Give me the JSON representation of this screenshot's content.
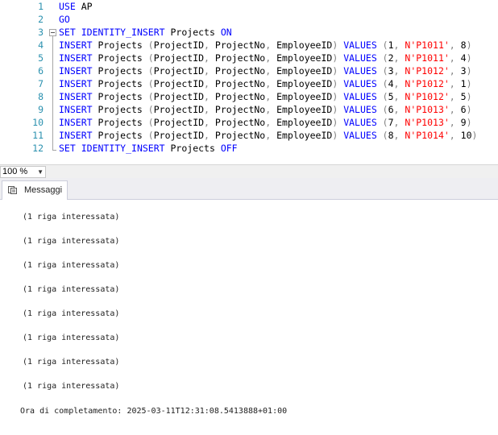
{
  "editor": {
    "lines": [
      {
        "n": "1",
        "tokens": [
          {
            "t": "USE",
            "c": "kw"
          },
          {
            "t": " AP",
            "c": ""
          }
        ]
      },
      {
        "n": "2",
        "tokens": [
          {
            "t": "GO",
            "c": "kw"
          }
        ]
      },
      {
        "n": "3",
        "tokens": [
          {
            "t": "SET",
            "c": "kw"
          },
          {
            "t": " ",
            "c": ""
          },
          {
            "t": "IDENTITY_INSERT",
            "c": "kw"
          },
          {
            "t": " Projects ",
            "c": ""
          },
          {
            "t": "ON",
            "c": "kw"
          }
        ]
      },
      {
        "n": "4",
        "tokens": [
          {
            "t": "INSERT",
            "c": "kw"
          },
          {
            "t": " Projects ",
            "c": ""
          },
          {
            "t": "(",
            "c": "gray"
          },
          {
            "t": "ProjectID",
            "c": ""
          },
          {
            "t": ", ",
            "c": "gray"
          },
          {
            "t": "ProjectNo",
            "c": ""
          },
          {
            "t": ", ",
            "c": "gray"
          },
          {
            "t": "EmployeeID",
            "c": ""
          },
          {
            "t": ")",
            "c": "gray"
          },
          {
            "t": " ",
            "c": ""
          },
          {
            "t": "VALUES",
            "c": "kw"
          },
          {
            "t": " (",
            "c": "gray"
          },
          {
            "t": "1",
            "c": ""
          },
          {
            "t": ", ",
            "c": "gray"
          },
          {
            "t": "N'P1011'",
            "c": "str"
          },
          {
            "t": ", ",
            "c": "gray"
          },
          {
            "t": "8",
            "c": ""
          },
          {
            "t": ")",
            "c": "gray"
          }
        ]
      },
      {
        "n": "5",
        "tokens": [
          {
            "t": "INSERT",
            "c": "kw"
          },
          {
            "t": " Projects ",
            "c": ""
          },
          {
            "t": "(",
            "c": "gray"
          },
          {
            "t": "ProjectID",
            "c": ""
          },
          {
            "t": ", ",
            "c": "gray"
          },
          {
            "t": "ProjectNo",
            "c": ""
          },
          {
            "t": ", ",
            "c": "gray"
          },
          {
            "t": "EmployeeID",
            "c": ""
          },
          {
            "t": ")",
            "c": "gray"
          },
          {
            "t": " ",
            "c": ""
          },
          {
            "t": "VALUES",
            "c": "kw"
          },
          {
            "t": " (",
            "c": "gray"
          },
          {
            "t": "2",
            "c": ""
          },
          {
            "t": ", ",
            "c": "gray"
          },
          {
            "t": "N'P1011'",
            "c": "str"
          },
          {
            "t": ", ",
            "c": "gray"
          },
          {
            "t": "4",
            "c": ""
          },
          {
            "t": ")",
            "c": "gray"
          }
        ]
      },
      {
        "n": "6",
        "tokens": [
          {
            "t": "INSERT",
            "c": "kw"
          },
          {
            "t": " Projects ",
            "c": ""
          },
          {
            "t": "(",
            "c": "gray"
          },
          {
            "t": "ProjectID",
            "c": ""
          },
          {
            "t": ", ",
            "c": "gray"
          },
          {
            "t": "ProjectNo",
            "c": ""
          },
          {
            "t": ", ",
            "c": "gray"
          },
          {
            "t": "EmployeeID",
            "c": ""
          },
          {
            "t": ")",
            "c": "gray"
          },
          {
            "t": " ",
            "c": ""
          },
          {
            "t": "VALUES",
            "c": "kw"
          },
          {
            "t": " (",
            "c": "gray"
          },
          {
            "t": "3",
            "c": ""
          },
          {
            "t": ", ",
            "c": "gray"
          },
          {
            "t": "N'P1012'",
            "c": "str"
          },
          {
            "t": ", ",
            "c": "gray"
          },
          {
            "t": "3",
            "c": ""
          },
          {
            "t": ")",
            "c": "gray"
          }
        ]
      },
      {
        "n": "7",
        "tokens": [
          {
            "t": "INSERT",
            "c": "kw"
          },
          {
            "t": " Projects ",
            "c": ""
          },
          {
            "t": "(",
            "c": "gray"
          },
          {
            "t": "ProjectID",
            "c": ""
          },
          {
            "t": ", ",
            "c": "gray"
          },
          {
            "t": "ProjectNo",
            "c": ""
          },
          {
            "t": ", ",
            "c": "gray"
          },
          {
            "t": "EmployeeID",
            "c": ""
          },
          {
            "t": ")",
            "c": "gray"
          },
          {
            "t": " ",
            "c": ""
          },
          {
            "t": "VALUES",
            "c": "kw"
          },
          {
            "t": " (",
            "c": "gray"
          },
          {
            "t": "4",
            "c": ""
          },
          {
            "t": ", ",
            "c": "gray"
          },
          {
            "t": "N'P1012'",
            "c": "str"
          },
          {
            "t": ", ",
            "c": "gray"
          },
          {
            "t": "1",
            "c": ""
          },
          {
            "t": ")",
            "c": "gray"
          }
        ]
      },
      {
        "n": "8",
        "tokens": [
          {
            "t": "INSERT",
            "c": "kw"
          },
          {
            "t": " Projects ",
            "c": ""
          },
          {
            "t": "(",
            "c": "gray"
          },
          {
            "t": "ProjectID",
            "c": ""
          },
          {
            "t": ", ",
            "c": "gray"
          },
          {
            "t": "ProjectNo",
            "c": ""
          },
          {
            "t": ", ",
            "c": "gray"
          },
          {
            "t": "EmployeeID",
            "c": ""
          },
          {
            "t": ")",
            "c": "gray"
          },
          {
            "t": " ",
            "c": ""
          },
          {
            "t": "VALUES",
            "c": "kw"
          },
          {
            "t": " (",
            "c": "gray"
          },
          {
            "t": "5",
            "c": ""
          },
          {
            "t": ", ",
            "c": "gray"
          },
          {
            "t": "N'P1012'",
            "c": "str"
          },
          {
            "t": ", ",
            "c": "gray"
          },
          {
            "t": "5",
            "c": ""
          },
          {
            "t": ")",
            "c": "gray"
          }
        ]
      },
      {
        "n": "9",
        "tokens": [
          {
            "t": "INSERT",
            "c": "kw"
          },
          {
            "t": " Projects ",
            "c": ""
          },
          {
            "t": "(",
            "c": "gray"
          },
          {
            "t": "ProjectID",
            "c": ""
          },
          {
            "t": ", ",
            "c": "gray"
          },
          {
            "t": "ProjectNo",
            "c": ""
          },
          {
            "t": ", ",
            "c": "gray"
          },
          {
            "t": "EmployeeID",
            "c": ""
          },
          {
            "t": ")",
            "c": "gray"
          },
          {
            "t": " ",
            "c": ""
          },
          {
            "t": "VALUES",
            "c": "kw"
          },
          {
            "t": " (",
            "c": "gray"
          },
          {
            "t": "6",
            "c": ""
          },
          {
            "t": ", ",
            "c": "gray"
          },
          {
            "t": "N'P1013'",
            "c": "str"
          },
          {
            "t": ", ",
            "c": "gray"
          },
          {
            "t": "6",
            "c": ""
          },
          {
            "t": ")",
            "c": "gray"
          }
        ]
      },
      {
        "n": "10",
        "tokens": [
          {
            "t": "INSERT",
            "c": "kw"
          },
          {
            "t": " Projects ",
            "c": ""
          },
          {
            "t": "(",
            "c": "gray"
          },
          {
            "t": "ProjectID",
            "c": ""
          },
          {
            "t": ", ",
            "c": "gray"
          },
          {
            "t": "ProjectNo",
            "c": ""
          },
          {
            "t": ", ",
            "c": "gray"
          },
          {
            "t": "EmployeeID",
            "c": ""
          },
          {
            "t": ")",
            "c": "gray"
          },
          {
            "t": " ",
            "c": ""
          },
          {
            "t": "VALUES",
            "c": "kw"
          },
          {
            "t": " (",
            "c": "gray"
          },
          {
            "t": "7",
            "c": ""
          },
          {
            "t": ", ",
            "c": "gray"
          },
          {
            "t": "N'P1013'",
            "c": "str"
          },
          {
            "t": ", ",
            "c": "gray"
          },
          {
            "t": "9",
            "c": ""
          },
          {
            "t": ")",
            "c": "gray"
          }
        ]
      },
      {
        "n": "11",
        "tokens": [
          {
            "t": "INSERT",
            "c": "kw"
          },
          {
            "t": " Projects ",
            "c": ""
          },
          {
            "t": "(",
            "c": "gray"
          },
          {
            "t": "ProjectID",
            "c": ""
          },
          {
            "t": ", ",
            "c": "gray"
          },
          {
            "t": "ProjectNo",
            "c": ""
          },
          {
            "t": ", ",
            "c": "gray"
          },
          {
            "t": "EmployeeID",
            "c": ""
          },
          {
            "t": ")",
            "c": "gray"
          },
          {
            "t": " ",
            "c": ""
          },
          {
            "t": "VALUES",
            "c": "kw"
          },
          {
            "t": " (",
            "c": "gray"
          },
          {
            "t": "8",
            "c": ""
          },
          {
            "t": ", ",
            "c": "gray"
          },
          {
            "t": "N'P1014'",
            "c": "str"
          },
          {
            "t": ", ",
            "c": "gray"
          },
          {
            "t": "10",
            "c": ""
          },
          {
            "t": ")",
            "c": "gray"
          }
        ]
      },
      {
        "n": "12",
        "tokens": [
          {
            "t": "SET",
            "c": "kw"
          },
          {
            "t": " ",
            "c": ""
          },
          {
            "t": "IDENTITY_INSERT",
            "c": "kw"
          },
          {
            "t": " Projects ",
            "c": ""
          },
          {
            "t": "OFF",
            "c": "kw"
          }
        ]
      }
    ]
  },
  "zoom": {
    "value": "100 %"
  },
  "tabs": {
    "messages_label": "Messaggi"
  },
  "messages": {
    "rows": [
      "(1 riga interessata)",
      "(1 riga interessata)",
      "(1 riga interessata)",
      "(1 riga interessata)",
      "(1 riga interessata)",
      "(1 riga interessata)",
      "(1 riga interessata)",
      "(1 riga interessata)"
    ],
    "completion": "Ora di completamento: 2025-03-11T12:31:08.5413888+01:00"
  },
  "colors": {
    "keyword": "#0000ff",
    "string": "#ff0000",
    "line_number": "#2b91af",
    "punctuation": "#808080"
  },
  "icons": {
    "messages_tab": "messages-icon",
    "zoom_dropdown": "chevron-down-icon",
    "fold_marker": "collapse-icon"
  }
}
